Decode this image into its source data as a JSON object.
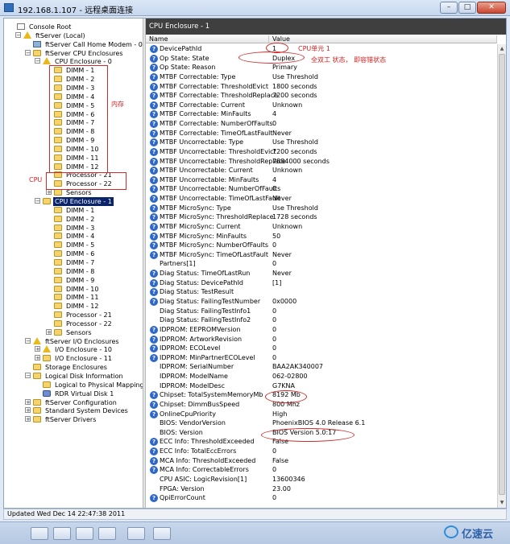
{
  "window": {
    "title": "192.168.1.107 - 远程桌面连接"
  },
  "tree": {
    "nodes": [
      {
        "label": "Console Root",
        "depth": 0,
        "icon": "root",
        "exp": "",
        "selected": false
      },
      {
        "label": "ftServer (Local)",
        "depth": 1,
        "icon": "warn",
        "exp": "-",
        "selected": false
      },
      {
        "label": "ftServer Call Home Modem - 0",
        "depth": 2,
        "icon": "modem",
        "exp": "",
        "selected": false
      },
      {
        "label": "ftServer CPU Enclosures",
        "depth": 2,
        "icon": "folder",
        "exp": "-",
        "selected": false
      },
      {
        "label": "CPU Enclosure - 0",
        "depth": 3,
        "icon": "warn",
        "exp": "-",
        "selected": false
      },
      {
        "label": "DIMM - 1",
        "depth": 4,
        "icon": "folder",
        "exp": "",
        "selected": false
      },
      {
        "label": "DIMM - 2",
        "depth": 4,
        "icon": "folder",
        "exp": "",
        "selected": false
      },
      {
        "label": "DIMM - 3",
        "depth": 4,
        "icon": "folder",
        "exp": "",
        "selected": false
      },
      {
        "label": "DIMM - 4",
        "depth": 4,
        "icon": "folder",
        "exp": "",
        "selected": false
      },
      {
        "label": "DIMM - 5",
        "depth": 4,
        "icon": "folder",
        "exp": "",
        "selected": false
      },
      {
        "label": "DIMM - 6",
        "depth": 4,
        "icon": "folder",
        "exp": "",
        "selected": false
      },
      {
        "label": "DIMM - 7",
        "depth": 4,
        "icon": "folder",
        "exp": "",
        "selected": false
      },
      {
        "label": "DIMM - 8",
        "depth": 4,
        "icon": "folder",
        "exp": "",
        "selected": false
      },
      {
        "label": "DIMM - 9",
        "depth": 4,
        "icon": "folder",
        "exp": "",
        "selected": false
      },
      {
        "label": "DIMM - 10",
        "depth": 4,
        "icon": "folder",
        "exp": "",
        "selected": false
      },
      {
        "label": "DIMM - 11",
        "depth": 4,
        "icon": "folder",
        "exp": "",
        "selected": false
      },
      {
        "label": "DIMM - 12",
        "depth": 4,
        "icon": "folder",
        "exp": "",
        "selected": false
      },
      {
        "label": "Processor - 21",
        "depth": 4,
        "icon": "folder",
        "exp": "",
        "selected": false
      },
      {
        "label": "Processor - 22",
        "depth": 4,
        "icon": "folder",
        "exp": "",
        "selected": false
      },
      {
        "label": "Sensors",
        "depth": 4,
        "icon": "folder",
        "exp": "+",
        "selected": false
      },
      {
        "label": "CPU Enclosure - 1",
        "depth": 3,
        "icon": "folder",
        "exp": "-",
        "selected": true
      },
      {
        "label": "DIMM - 1",
        "depth": 4,
        "icon": "folder",
        "exp": "",
        "selected": false
      },
      {
        "label": "DIMM - 2",
        "depth": 4,
        "icon": "folder",
        "exp": "",
        "selected": false
      },
      {
        "label": "DIMM - 3",
        "depth": 4,
        "icon": "folder",
        "exp": "",
        "selected": false
      },
      {
        "label": "DIMM - 4",
        "depth": 4,
        "icon": "folder",
        "exp": "",
        "selected": false
      },
      {
        "label": "DIMM - 5",
        "depth": 4,
        "icon": "folder",
        "exp": "",
        "selected": false
      },
      {
        "label": "DIMM - 6",
        "depth": 4,
        "icon": "folder",
        "exp": "",
        "selected": false
      },
      {
        "label": "DIMM - 7",
        "depth": 4,
        "icon": "folder",
        "exp": "",
        "selected": false
      },
      {
        "label": "DIMM - 8",
        "depth": 4,
        "icon": "folder",
        "exp": "",
        "selected": false
      },
      {
        "label": "DIMM - 9",
        "depth": 4,
        "icon": "folder",
        "exp": "",
        "selected": false
      },
      {
        "label": "DIMM - 10",
        "depth": 4,
        "icon": "folder",
        "exp": "",
        "selected": false
      },
      {
        "label": "DIMM - 11",
        "depth": 4,
        "icon": "folder",
        "exp": "",
        "selected": false
      },
      {
        "label": "DIMM - 12",
        "depth": 4,
        "icon": "folder",
        "exp": "",
        "selected": false
      },
      {
        "label": "Processor - 21",
        "depth": 4,
        "icon": "folder",
        "exp": "",
        "selected": false
      },
      {
        "label": "Processor - 22",
        "depth": 4,
        "icon": "folder",
        "exp": "",
        "selected": false
      },
      {
        "label": "Sensors",
        "depth": 4,
        "icon": "folder",
        "exp": "+",
        "selected": false
      },
      {
        "label": "ftServer I/O Enclosures",
        "depth": 2,
        "icon": "warn",
        "exp": "-",
        "selected": false
      },
      {
        "label": "I/O Enclosure - 10",
        "depth": 3,
        "icon": "warn",
        "exp": "+",
        "selected": false
      },
      {
        "label": "I/O Enclosure - 11",
        "depth": 3,
        "icon": "folder",
        "exp": "+",
        "selected": false
      },
      {
        "label": "Storage Enclosures",
        "depth": 2,
        "icon": "folder",
        "exp": "",
        "selected": false
      },
      {
        "label": "Logical Disk Information",
        "depth": 2,
        "icon": "folder",
        "exp": "-",
        "selected": false
      },
      {
        "label": "Logical to Physical Mapping",
        "depth": 3,
        "icon": "folder",
        "exp": "",
        "selected": false
      },
      {
        "label": "RDR Virtual Disk 1",
        "depth": 3,
        "icon": "disk",
        "exp": "",
        "selected": false
      },
      {
        "label": "ftServer Configuration",
        "depth": 2,
        "icon": "folder",
        "exp": "+",
        "selected": false
      },
      {
        "label": "Standard System Devices",
        "depth": 2,
        "icon": "folder",
        "exp": "+",
        "selected": false
      },
      {
        "label": "ftServer Drivers",
        "depth": 2,
        "icon": "folder",
        "exp": "+",
        "selected": false
      }
    ]
  },
  "panel": {
    "title": "CPU Enclosure - 1",
    "col_name": "Name",
    "col_value": "Value",
    "rows": [
      {
        "name": "DevicePathId",
        "value": "1",
        "icon": true
      },
      {
        "name": "Op State: State",
        "value": "Duplex",
        "icon": true
      },
      {
        "name": "Op State: Reason",
        "value": "Primary",
        "icon": true
      },
      {
        "name": "MTBF Correctable: Type",
        "value": "Use Threshold",
        "icon": true
      },
      {
        "name": "MTBF Correctable: ThresholdEvict",
        "value": "1800 seconds",
        "icon": true
      },
      {
        "name": "MTBF Correctable: ThresholdReplace",
        "value": "7200 seconds",
        "icon": true
      },
      {
        "name": "MTBF Correctable: Current",
        "value": "Unknown",
        "icon": true
      },
      {
        "name": "MTBF Correctable: MinFaults",
        "value": "4",
        "icon": true
      },
      {
        "name": "MTBF Correctable: NumberOfFaults",
        "value": "0",
        "icon": true
      },
      {
        "name": "MTBF Correctable: TimeOfLastFault",
        "value": "Never",
        "icon": true
      },
      {
        "name": "MTBF Uncorrectable: Type",
        "value": "Use Threshold",
        "icon": true
      },
      {
        "name": "MTBF Uncorrectable: ThresholdEvict",
        "value": "7200 seconds",
        "icon": true
      },
      {
        "name": "MTBF Uncorrectable: ThresholdReplace",
        "value": "7884000 seconds",
        "icon": true
      },
      {
        "name": "MTBF Uncorrectable: Current",
        "value": "Unknown",
        "icon": true
      },
      {
        "name": "MTBF Uncorrectable: MinFaults",
        "value": "4",
        "icon": true
      },
      {
        "name": "MTBF Uncorrectable: NumberOfFaults",
        "value": "0",
        "icon": true
      },
      {
        "name": "MTBF Uncorrectable: TimeOfLastFault",
        "value": "Never",
        "icon": true
      },
      {
        "name": "MTBF MicroSync: Type",
        "value": "Use Threshold",
        "icon": true
      },
      {
        "name": "MTBF MicroSync: ThresholdReplace",
        "value": "1728 seconds",
        "icon": true
      },
      {
        "name": "MTBF MicroSync: Current",
        "value": "Unknown",
        "icon": true
      },
      {
        "name": "MTBF MicroSync: MinFaults",
        "value": "50",
        "icon": true
      },
      {
        "name": "MTBF MicroSync: NumberOfFaults",
        "value": "0",
        "icon": true
      },
      {
        "name": "MTBF MicroSync: TimeOfLastFault",
        "value": "Never",
        "icon": true
      },
      {
        "name": "Partners[1]",
        "value": "0",
        "icon": false
      },
      {
        "name": "Diag Status: TimeOfLastRun",
        "value": "Never",
        "icon": true
      },
      {
        "name": "Diag Status: DevicePathId",
        "value": "[1]",
        "icon": true
      },
      {
        "name": "Diag Status: TestResult",
        "value": "",
        "icon": true
      },
      {
        "name": "Diag Status: FailingTestNumber",
        "value": "0x0000",
        "icon": true
      },
      {
        "name": "Diag Status: FailingTestInfo1",
        "value": "0",
        "icon": false
      },
      {
        "name": "Diag Status: FailingTestInfo2",
        "value": "0",
        "icon": false
      },
      {
        "name": "IDPROM: EEPROMVersion",
        "value": "0",
        "icon": true
      },
      {
        "name": "IDPROM: ArtworkRevision",
        "value": "0",
        "icon": true
      },
      {
        "name": "IDPROM: ECOLevel",
        "value": "0",
        "icon": true
      },
      {
        "name": "IDPROM: MinPartnerECOLevel",
        "value": "0",
        "icon": true
      },
      {
        "name": "IDPROM: SerialNumber",
        "value": "BAA2AK340007",
        "icon": false
      },
      {
        "name": "IDPROM: ModelName",
        "value": "062-02800",
        "icon": false
      },
      {
        "name": "IDPROM: ModelDesc",
        "value": "G7KNA",
        "icon": false
      },
      {
        "name": "Chipset: TotalSystemMemoryMb",
        "value": "8192 Mb",
        "icon": true
      },
      {
        "name": "Chipset: DimmBusSpeed",
        "value": "800 Mhz",
        "icon": true
      },
      {
        "name": "OnlineCpuPriority",
        "value": "High",
        "icon": true
      },
      {
        "name": "BIOS: VendorVersion",
        "value": "PhoenixBIOS 4.0 Release 6.1",
        "icon": false
      },
      {
        "name": "BIOS: Version",
        "value": "BIOS Version 5.0:17",
        "icon": false
      },
      {
        "name": "ECC Info: ThresholdExceeded",
        "value": "False",
        "icon": true
      },
      {
        "name": "ECC Info: TotalEccErrors",
        "value": "0",
        "icon": true
      },
      {
        "name": "MCA Info: ThresholdExceeded",
        "value": "False",
        "icon": true
      },
      {
        "name": "MCA Info: CorrectableErrors",
        "value": "0",
        "icon": true
      },
      {
        "name": "CPU ASIC: LogicRevision[1]",
        "value": "13600346",
        "icon": false
      },
      {
        "name": "FPGA: Version",
        "value": "23.00",
        "icon": false
      },
      {
        "name": "QpiErrorCount",
        "value": "0",
        "icon": true
      }
    ]
  },
  "annotations": {
    "memory": "内存",
    "cpu": "CPU",
    "cpu_unit": "CPU单元 1",
    "duplex_note": "全双工 状态， 即容错状态"
  },
  "status": {
    "text": "Updated Wed Dec 14 22:47:38 2011"
  },
  "watermark": {
    "text": "亿速云"
  },
  "colors": {
    "header_bg": "#3f3f3f",
    "selection": "#0a246a",
    "annotation": "#d12a2a",
    "info_icon": "#2d67c8"
  }
}
